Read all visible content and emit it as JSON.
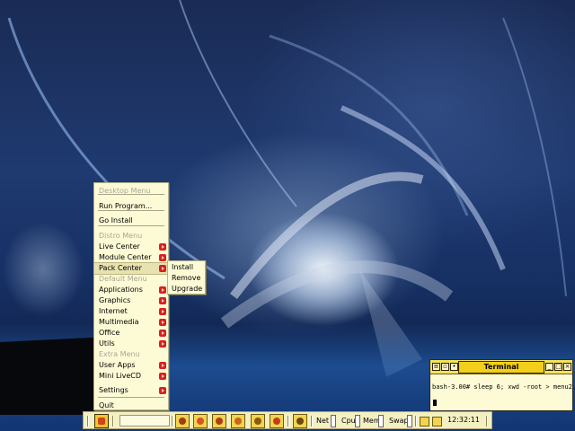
{
  "menu": {
    "items": [
      {
        "label": "Desktop Menu",
        "type": "header"
      },
      {
        "label": "Run Program...",
        "type": "item"
      },
      {
        "label": "Go Install",
        "type": "item"
      },
      {
        "label": "Distro Menu",
        "type": "header"
      },
      {
        "label": "Live Center",
        "type": "submenu"
      },
      {
        "label": "Module Center",
        "type": "submenu"
      },
      {
        "label": "Pack Center",
        "type": "submenu",
        "active": true
      },
      {
        "label": "Default Menu",
        "type": "header"
      },
      {
        "label": "Applications",
        "type": "submenu"
      },
      {
        "label": "Graphics",
        "type": "submenu"
      },
      {
        "label": "Internet",
        "type": "submenu"
      },
      {
        "label": "Multimedia",
        "type": "submenu"
      },
      {
        "label": "Office",
        "type": "submenu"
      },
      {
        "label": "Utils",
        "type": "submenu"
      },
      {
        "label": "Extra Menu",
        "type": "header"
      },
      {
        "label": "User Apps",
        "type": "submenu"
      },
      {
        "label": "Mini LiveCD",
        "type": "submenu"
      },
      {
        "label": "Settings",
        "type": "submenu"
      },
      {
        "label": "Quit",
        "type": "item"
      }
    ]
  },
  "submenu": {
    "items": [
      "Install",
      "Remove",
      "Upgrade"
    ]
  },
  "terminal": {
    "title": "Terminal",
    "line": "bash-3.00# sleep 6; xwd -root > menu2.jpg"
  },
  "taskbar": {
    "labels": {
      "net": "Net",
      "cpu": "Cpu",
      "mem": "Mem",
      "swap": "Swap"
    },
    "clock": "12:32:11",
    "launchers": [
      "terminal-icon",
      "browser-icon",
      "music-icon",
      "chat-icon",
      "editor-icon",
      "files-icon",
      "desktop-icon"
    ]
  },
  "colors": {
    "menu_bg": "#fdfbd6",
    "menu_arrow": "#d82020",
    "title_yellow": "#f2cf1a"
  }
}
